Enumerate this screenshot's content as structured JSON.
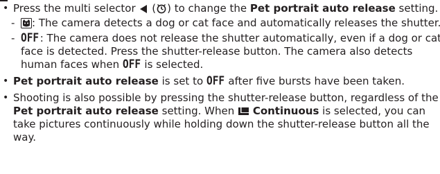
{
  "bullet1": {
    "prefix": "Press the multi selector",
    "multi_selector_icon": "left-arrow-icon",
    "self_timer_icon": "self-timer-icon",
    "middle": "to change the",
    "setting_name": "Pet portrait auto release",
    "suffix": "setting."
  },
  "sub1": {
    "icon": "pet-portrait-icon",
    "text": ": The camera detects a dog or cat face and automatically releases the shutter."
  },
  "sub2": {
    "off_label": "OFF",
    "line1": ": The camera does not release the shutter automatically, even if a dog or cat",
    "line2": "face is detected. Press the shutter-release button. The camera also detects",
    "line3a": "human faces when",
    "line3b": "is selected."
  },
  "bullet2": {
    "setting_name": "Pet portrait auto release",
    "middle": "is set to",
    "suffix": "after five bursts have been taken."
  },
  "bullet3": {
    "line1": "Shooting is also possible by pressing the shutter-release button, regardless of the",
    "setting_name": "Pet portrait auto release",
    "line2b": "setting. When",
    "continuous_icon": "continuous-shooting-icon",
    "continuous_label": "Continuous",
    "line2c": "is selected, you can",
    "line3": "take pictures continuously while holding down the shutter-release button all the",
    "line4": "way."
  }
}
